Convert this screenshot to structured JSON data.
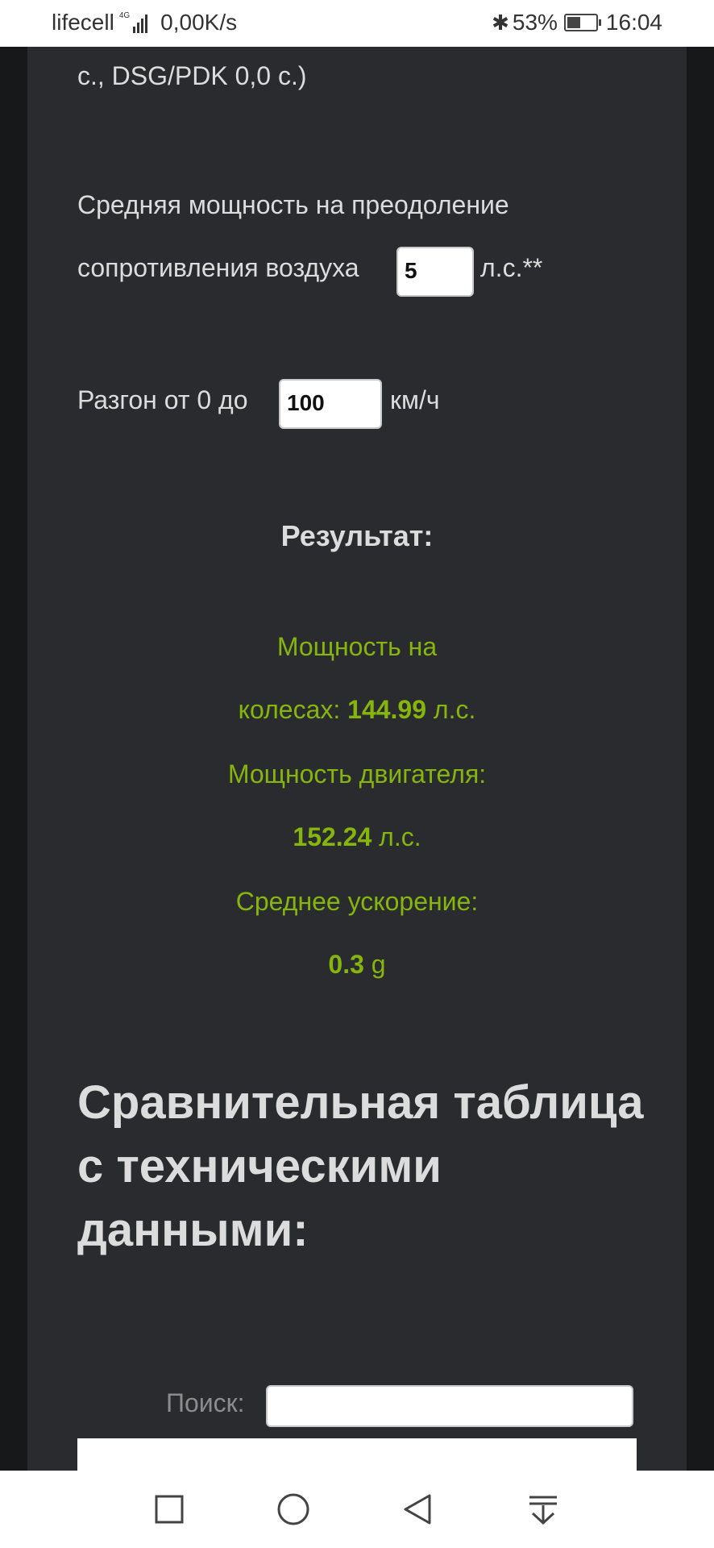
{
  "status_bar": {
    "carrier": "lifecell",
    "network": "4G",
    "speed": "0,00K/s",
    "battery": "53%",
    "battery_level": 0.53,
    "time": "16:04"
  },
  "form": {
    "prev_text": "с., DSG/PDK 0,0 с.)",
    "air_power_label_line1": "Средняя мощность на преодоление",
    "air_power_label_line2": "сопротивления воздуха",
    "air_power_value": "5",
    "air_power_unit": "л.с.**",
    "accel_label": "Разгон от 0 до",
    "accel_value": "100",
    "accel_unit": "км/ч"
  },
  "result": {
    "title": "Результат:",
    "wheel_power_label1": "Мощность на",
    "wheel_power_label2": "колесах:",
    "wheel_power_value": "144.99",
    "wheel_power_unit": "л.с.",
    "engine_power_label": "Мощность двигателя:",
    "engine_power_value": "152.24",
    "engine_power_unit": "л.с.",
    "avg_accel_label": "Среднее ускорение:",
    "avg_accel_value": "0.3",
    "avg_accel_unit": "g"
  },
  "comparison": {
    "heading": "Сравнительная таблица с техническими данными:",
    "search_label": "Поиск:",
    "search_value": ""
  },
  "colors": {
    "panel_bg": "#2a2b2e",
    "accent_green": "#86b50b",
    "text": "#dcdcdc"
  }
}
